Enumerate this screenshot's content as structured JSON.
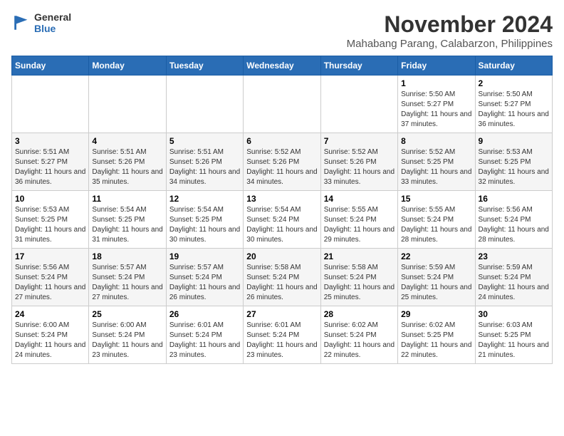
{
  "header": {
    "logo_general": "General",
    "logo_blue": "Blue",
    "month_year": "November 2024",
    "location": "Mahabang Parang, Calabarzon, Philippines"
  },
  "days_of_week": [
    "Sunday",
    "Monday",
    "Tuesday",
    "Wednesday",
    "Thursday",
    "Friday",
    "Saturday"
  ],
  "weeks": [
    [
      {
        "day": "",
        "info": ""
      },
      {
        "day": "",
        "info": ""
      },
      {
        "day": "",
        "info": ""
      },
      {
        "day": "",
        "info": ""
      },
      {
        "day": "",
        "info": ""
      },
      {
        "day": "1",
        "info": "Sunrise: 5:50 AM\nSunset: 5:27 PM\nDaylight: 11 hours and 37 minutes."
      },
      {
        "day": "2",
        "info": "Sunrise: 5:50 AM\nSunset: 5:27 PM\nDaylight: 11 hours and 36 minutes."
      }
    ],
    [
      {
        "day": "3",
        "info": "Sunrise: 5:51 AM\nSunset: 5:27 PM\nDaylight: 11 hours and 36 minutes."
      },
      {
        "day": "4",
        "info": "Sunrise: 5:51 AM\nSunset: 5:26 PM\nDaylight: 11 hours and 35 minutes."
      },
      {
        "day": "5",
        "info": "Sunrise: 5:51 AM\nSunset: 5:26 PM\nDaylight: 11 hours and 34 minutes."
      },
      {
        "day": "6",
        "info": "Sunrise: 5:52 AM\nSunset: 5:26 PM\nDaylight: 11 hours and 34 minutes."
      },
      {
        "day": "7",
        "info": "Sunrise: 5:52 AM\nSunset: 5:26 PM\nDaylight: 11 hours and 33 minutes."
      },
      {
        "day": "8",
        "info": "Sunrise: 5:52 AM\nSunset: 5:25 PM\nDaylight: 11 hours and 33 minutes."
      },
      {
        "day": "9",
        "info": "Sunrise: 5:53 AM\nSunset: 5:25 PM\nDaylight: 11 hours and 32 minutes."
      }
    ],
    [
      {
        "day": "10",
        "info": "Sunrise: 5:53 AM\nSunset: 5:25 PM\nDaylight: 11 hours and 31 minutes."
      },
      {
        "day": "11",
        "info": "Sunrise: 5:54 AM\nSunset: 5:25 PM\nDaylight: 11 hours and 31 minutes."
      },
      {
        "day": "12",
        "info": "Sunrise: 5:54 AM\nSunset: 5:25 PM\nDaylight: 11 hours and 30 minutes."
      },
      {
        "day": "13",
        "info": "Sunrise: 5:54 AM\nSunset: 5:24 PM\nDaylight: 11 hours and 30 minutes."
      },
      {
        "day": "14",
        "info": "Sunrise: 5:55 AM\nSunset: 5:24 PM\nDaylight: 11 hours and 29 minutes."
      },
      {
        "day": "15",
        "info": "Sunrise: 5:55 AM\nSunset: 5:24 PM\nDaylight: 11 hours and 28 minutes."
      },
      {
        "day": "16",
        "info": "Sunrise: 5:56 AM\nSunset: 5:24 PM\nDaylight: 11 hours and 28 minutes."
      }
    ],
    [
      {
        "day": "17",
        "info": "Sunrise: 5:56 AM\nSunset: 5:24 PM\nDaylight: 11 hours and 27 minutes."
      },
      {
        "day": "18",
        "info": "Sunrise: 5:57 AM\nSunset: 5:24 PM\nDaylight: 11 hours and 27 minutes."
      },
      {
        "day": "19",
        "info": "Sunrise: 5:57 AM\nSunset: 5:24 PM\nDaylight: 11 hours and 26 minutes."
      },
      {
        "day": "20",
        "info": "Sunrise: 5:58 AM\nSunset: 5:24 PM\nDaylight: 11 hours and 26 minutes."
      },
      {
        "day": "21",
        "info": "Sunrise: 5:58 AM\nSunset: 5:24 PM\nDaylight: 11 hours and 25 minutes."
      },
      {
        "day": "22",
        "info": "Sunrise: 5:59 AM\nSunset: 5:24 PM\nDaylight: 11 hours and 25 minutes."
      },
      {
        "day": "23",
        "info": "Sunrise: 5:59 AM\nSunset: 5:24 PM\nDaylight: 11 hours and 24 minutes."
      }
    ],
    [
      {
        "day": "24",
        "info": "Sunrise: 6:00 AM\nSunset: 5:24 PM\nDaylight: 11 hours and 24 minutes."
      },
      {
        "day": "25",
        "info": "Sunrise: 6:00 AM\nSunset: 5:24 PM\nDaylight: 11 hours and 23 minutes."
      },
      {
        "day": "26",
        "info": "Sunrise: 6:01 AM\nSunset: 5:24 PM\nDaylight: 11 hours and 23 minutes."
      },
      {
        "day": "27",
        "info": "Sunrise: 6:01 AM\nSunset: 5:24 PM\nDaylight: 11 hours and 23 minutes."
      },
      {
        "day": "28",
        "info": "Sunrise: 6:02 AM\nSunset: 5:24 PM\nDaylight: 11 hours and 22 minutes."
      },
      {
        "day": "29",
        "info": "Sunrise: 6:02 AM\nSunset: 5:25 PM\nDaylight: 11 hours and 22 minutes."
      },
      {
        "day": "30",
        "info": "Sunrise: 6:03 AM\nSunset: 5:25 PM\nDaylight: 11 hours and 21 minutes."
      }
    ]
  ]
}
